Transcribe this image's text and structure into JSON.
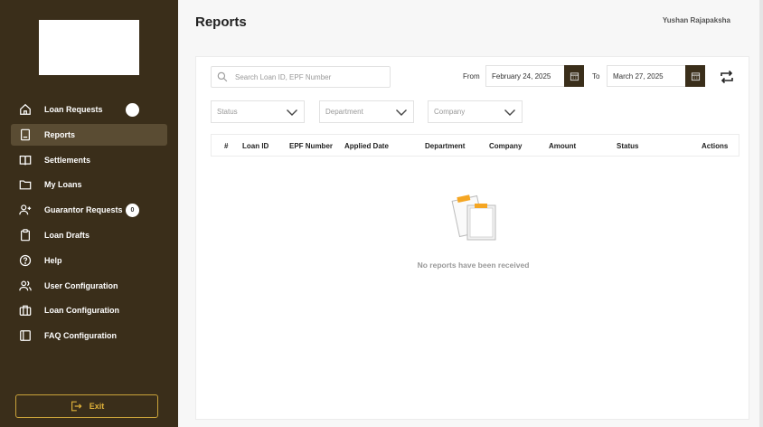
{
  "sidebar": {
    "items": [
      {
        "label": "Loan Requests",
        "icon": "home-icon"
      },
      {
        "label": "Reports",
        "icon": "report-icon"
      },
      {
        "label": "Settlements",
        "icon": "book-icon"
      },
      {
        "label": "My Loans",
        "icon": "folder-icon"
      },
      {
        "label": "Guarantor Requests",
        "icon": "user-plus-icon",
        "badge": "0"
      },
      {
        "label": "Loan Drafts",
        "icon": "clipboard-icon"
      },
      {
        "label": "Help",
        "icon": "help-icon"
      },
      {
        "label": "User Configuration",
        "icon": "users-icon"
      },
      {
        "label": "Loan Configuration",
        "icon": "briefcase-icon"
      },
      {
        "label": "FAQ Configuration",
        "icon": "faq-book-icon"
      }
    ],
    "exit_label": "Exit"
  },
  "header": {
    "title": "Reports",
    "user_name": "Yushan Rajapaksha"
  },
  "filters": {
    "search_placeholder": "Search Loan ID, EPF Number",
    "from_label": "From",
    "from_date": "February 24, 2025",
    "to_label": "To",
    "to_date": "March 27, 2025",
    "status_placeholder": "Status",
    "department_placeholder": "Department",
    "company_placeholder": "Company"
  },
  "table": {
    "columns": [
      "#",
      "Loan ID",
      "EPF Number",
      "Applied Date",
      "Department",
      "Company",
      "Amount",
      "Status",
      "Actions"
    ],
    "rows": []
  },
  "empty_state": {
    "message": "No reports have been received"
  },
  "colors": {
    "sidebar_bg": "#3a2e1a",
    "active_item_bg": "#5a4c33",
    "accent": "#e0b23a"
  }
}
